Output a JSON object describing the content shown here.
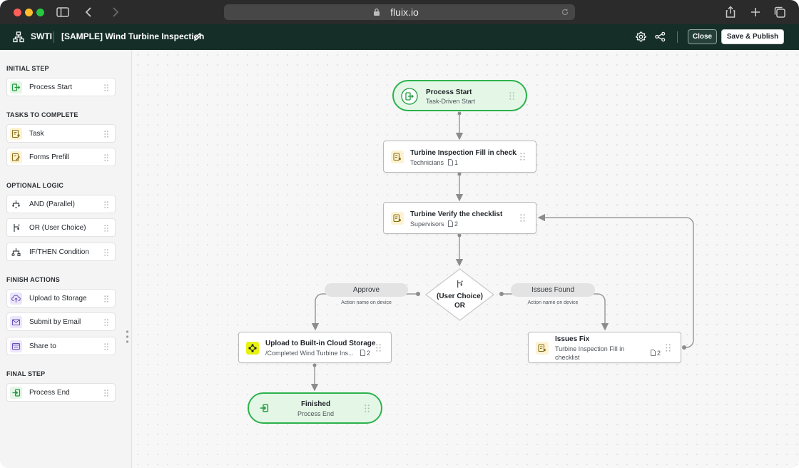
{
  "browser": {
    "url": "fluix.io"
  },
  "header": {
    "code": "SWTI",
    "title": "[SAMPLE] Wind Turbine Inspection",
    "close_label": "Close",
    "publish_label": "Save & Publish"
  },
  "sidebar": {
    "sections": [
      {
        "heading": "INITIAL STEP",
        "items": [
          {
            "label": "Process Start",
            "icon": "process-start-icon"
          }
        ]
      },
      {
        "heading": "TASKS TO COMPLETE",
        "items": [
          {
            "label": "Task",
            "icon": "task-icon"
          },
          {
            "label": "Forms Prefill",
            "icon": "forms-prefill-icon"
          }
        ]
      },
      {
        "heading": "OPTIONAL LOGIC",
        "items": [
          {
            "label": "AND (Parallel)",
            "icon": "and-parallel-icon"
          },
          {
            "label": "OR (User Choice)",
            "icon": "or-choice-icon"
          },
          {
            "label": "IF/THEN Condition",
            "icon": "if-then-icon"
          }
        ]
      },
      {
        "heading": "FINISH ACTIONS",
        "items": [
          {
            "label": "Upload to Storage",
            "icon": "upload-icon"
          },
          {
            "label": "Submit by Email",
            "icon": "email-icon"
          },
          {
            "label": "Share to",
            "icon": "share-to-icon"
          }
        ]
      },
      {
        "heading": "FINAL STEP",
        "items": [
          {
            "label": "Process End",
            "icon": "process-end-icon"
          }
        ]
      }
    ]
  },
  "flow": {
    "start": {
      "title": "Process Start",
      "subtitle": "Task-Driven Start"
    },
    "task1": {
      "title": "Turbine Inspection Fill in check...",
      "assignee": "Technicians",
      "docs": "1"
    },
    "task2": {
      "title": "Turbine Verify the checklist",
      "assignee": "Supervisors",
      "docs": "2"
    },
    "decision": {
      "label": "(User Choice)",
      "type": "OR"
    },
    "branch_left": {
      "label": "Approve",
      "sub": "Action name on device"
    },
    "branch_right": {
      "label": "Issues Found",
      "sub": "Action name on device"
    },
    "upload": {
      "title": "Upload to Built-in Cloud Storage",
      "path": "/Completed Wind Turbine Ins...",
      "docs": "2"
    },
    "issues": {
      "title": "Issues Fix",
      "line1": "Turbine Inspection Fill in",
      "line2": "checklist",
      "docs": "2"
    },
    "finished": {
      "title": "Finished",
      "subtitle": "Process End"
    }
  },
  "colors": {
    "header_bg": "#152e28",
    "start_green": "#2bb24c",
    "task_badge": "#fdf3d2",
    "upload_badge": "#e6f213"
  }
}
